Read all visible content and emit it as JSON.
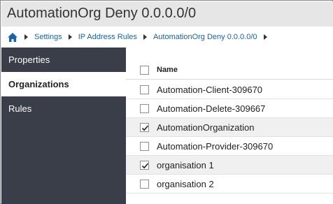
{
  "window": {
    "title": "AutomationOrg Deny 0.0.0.0/0"
  },
  "breadcrumb": {
    "home_icon": "home-icon",
    "items": [
      "Settings",
      "IP Address Rules",
      "AutomationOrg Deny 0.0.0.0/0"
    ]
  },
  "sidebar": {
    "items": [
      {
        "label": "Properties",
        "active": false
      },
      {
        "label": "Organizations",
        "active": true
      },
      {
        "label": "Rules",
        "active": false
      }
    ]
  },
  "table": {
    "column_name": "Name",
    "header_checked": false,
    "rows": [
      {
        "name": "Automation-Client-309670",
        "checked": false
      },
      {
        "name": "Automation-Delete-309667",
        "checked": false
      },
      {
        "name": "AutomationOrganization",
        "checked": true
      },
      {
        "name": "Automation-Provider-309670",
        "checked": false
      },
      {
        "name": "organisation 1",
        "checked": true
      },
      {
        "name": "organisation 2",
        "checked": false
      }
    ]
  },
  "colors": {
    "sidebar_bg": "#3a3e48",
    "link": "#1464b4",
    "selected_row": "#f0f0f0"
  }
}
